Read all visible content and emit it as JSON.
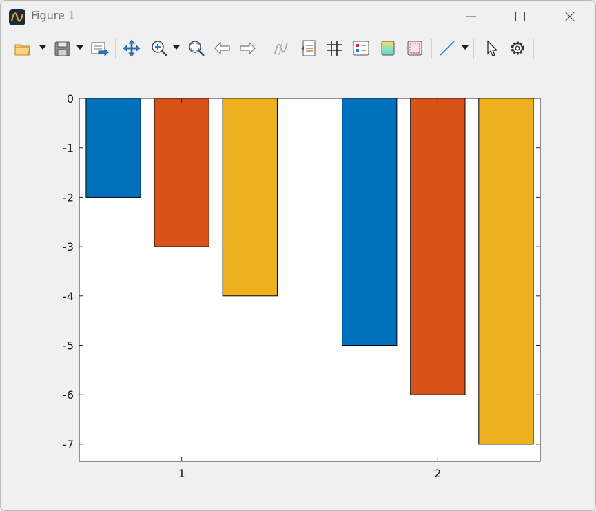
{
  "window": {
    "title": "Figure 1",
    "controls": [
      "minimize-icon",
      "maximize-icon",
      "close-icon"
    ]
  },
  "toolbar": {
    "items": [
      "open-folder-icon",
      "save-icon",
      "export-icon",
      "pan-icon",
      "zoom-in-icon",
      "zoom-fit-icon",
      "back-arrow-icon",
      "forward-arrow-icon",
      "datatip-icon",
      "insert-text-icon",
      "grid-icon",
      "legend-icon",
      "colorbar-icon",
      "box-icon",
      "line-icon",
      "pointer-icon",
      "settings-icon"
    ]
  },
  "colors": {
    "series1": "#0072bd",
    "series2": "#d95319",
    "series3": "#edb120"
  },
  "chart_data": {
    "type": "bar",
    "categories": [
      "1",
      "2"
    ],
    "series": [
      {
        "values": [
          -2,
          -5
        ]
      },
      {
        "values": [
          -3,
          -6
        ]
      },
      {
        "values": [
          -4,
          -7
        ]
      }
    ],
    "ylim": [
      -7.35,
      0
    ],
    "yticks": [
      "0",
      "-1",
      "-2",
      "-3",
      "-4",
      "-5",
      "-6",
      "-7"
    ],
    "ytick_values": [
      0,
      -1,
      -2,
      -3,
      -4,
      -5,
      -6,
      -7
    ],
    "xticks": [
      "1",
      "2"
    ],
    "grid": false,
    "title": "",
    "xlabel": "",
    "ylabel": ""
  }
}
